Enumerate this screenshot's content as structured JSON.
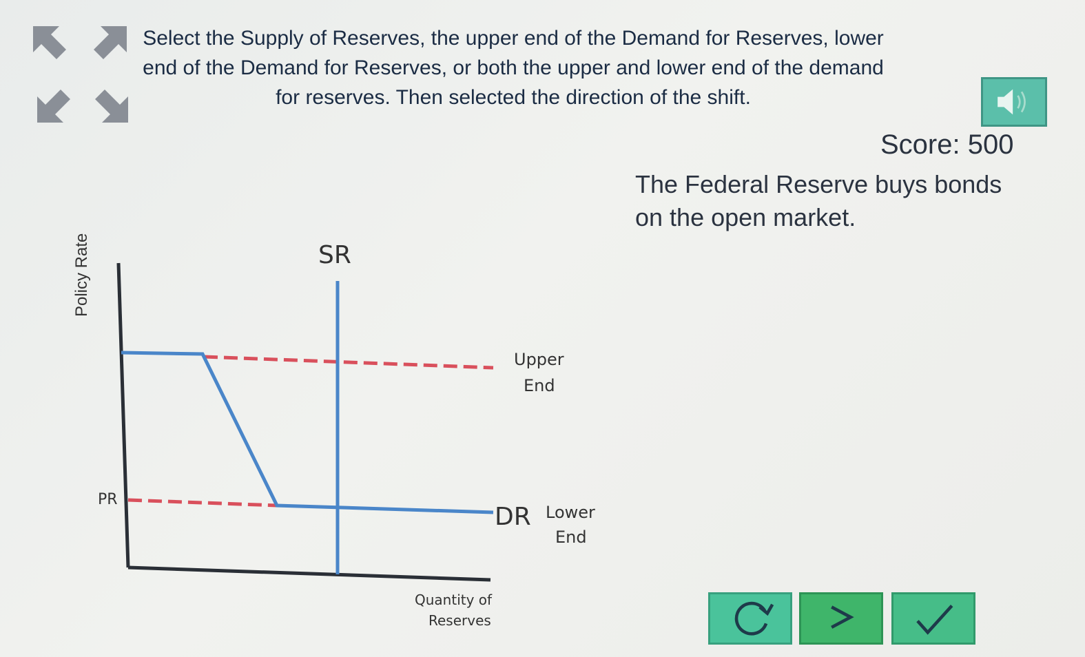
{
  "instructions": "Select the Supply of Reserves, the upper end of the Demand for Reserves, lower end of the Demand for Reserves, or both the upper and lower end of the demand for reserves. Then selected the direction of the shift.",
  "score": {
    "label": "Score:",
    "value": "500"
  },
  "scenario": "The Federal Reserve buys bonds on the open market.",
  "graph": {
    "y_axis_label": "Policy Rate",
    "x_axis_label": "Quantity of Reserves",
    "pr_label": "PR",
    "supply_label": "SR",
    "demand_label": "DR",
    "upper_end_label": "Upper End",
    "lower_end_label": "Lower End"
  },
  "icons": {
    "arrow_up_left": "arrow-up-left-icon",
    "arrow_up_right": "arrow-up-right-icon",
    "arrow_down_left": "arrow-down-left-icon",
    "arrow_down_right": "arrow-down-right-icon",
    "audio": "speaker-icon",
    "reset": "reset-icon",
    "next": "chevron-right-icon",
    "check": "checkmark-icon"
  },
  "colors": {
    "curve_blue": "#4a86c9",
    "dashed_red": "#d9505c",
    "button_green": "#4ac39b",
    "arrow_gray": "#8a8f97"
  }
}
